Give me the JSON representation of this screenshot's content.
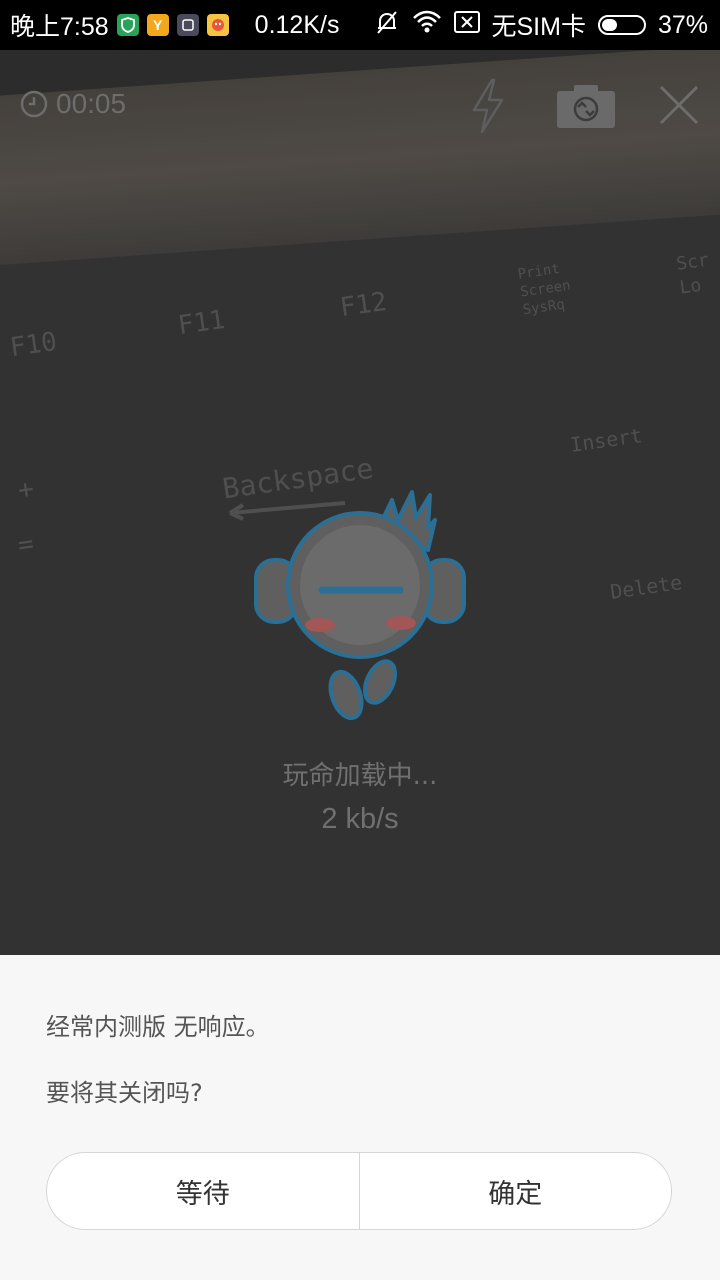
{
  "status_bar": {
    "time": "晚上7:58",
    "net_speed": "0.12K/s",
    "sim": "无SIM卡",
    "battery": "37%",
    "battery_level": 0.37,
    "app_icons": [
      "shield-app-icon",
      "y-app-icon",
      "apps-icon",
      "game-app-icon"
    ]
  },
  "camera": {
    "timer": "00:05",
    "key_labels": [
      "F10",
      "F11",
      "F12",
      "Print Screen SysRq",
      "Scr Lo",
      "Backspace",
      "Insert",
      "Delete",
      "+",
      "="
    ]
  },
  "loading": {
    "text": "玩命加载中...",
    "speed": "2 kb/s"
  },
  "dialog": {
    "message": "经常内测版 无响应。",
    "question": "要将其关闭吗?",
    "wait_label": "等待",
    "ok_label": "确定"
  },
  "colors": {
    "mascot_outline": "#2b6f95",
    "dialog_bg": "#f7f7f7"
  }
}
